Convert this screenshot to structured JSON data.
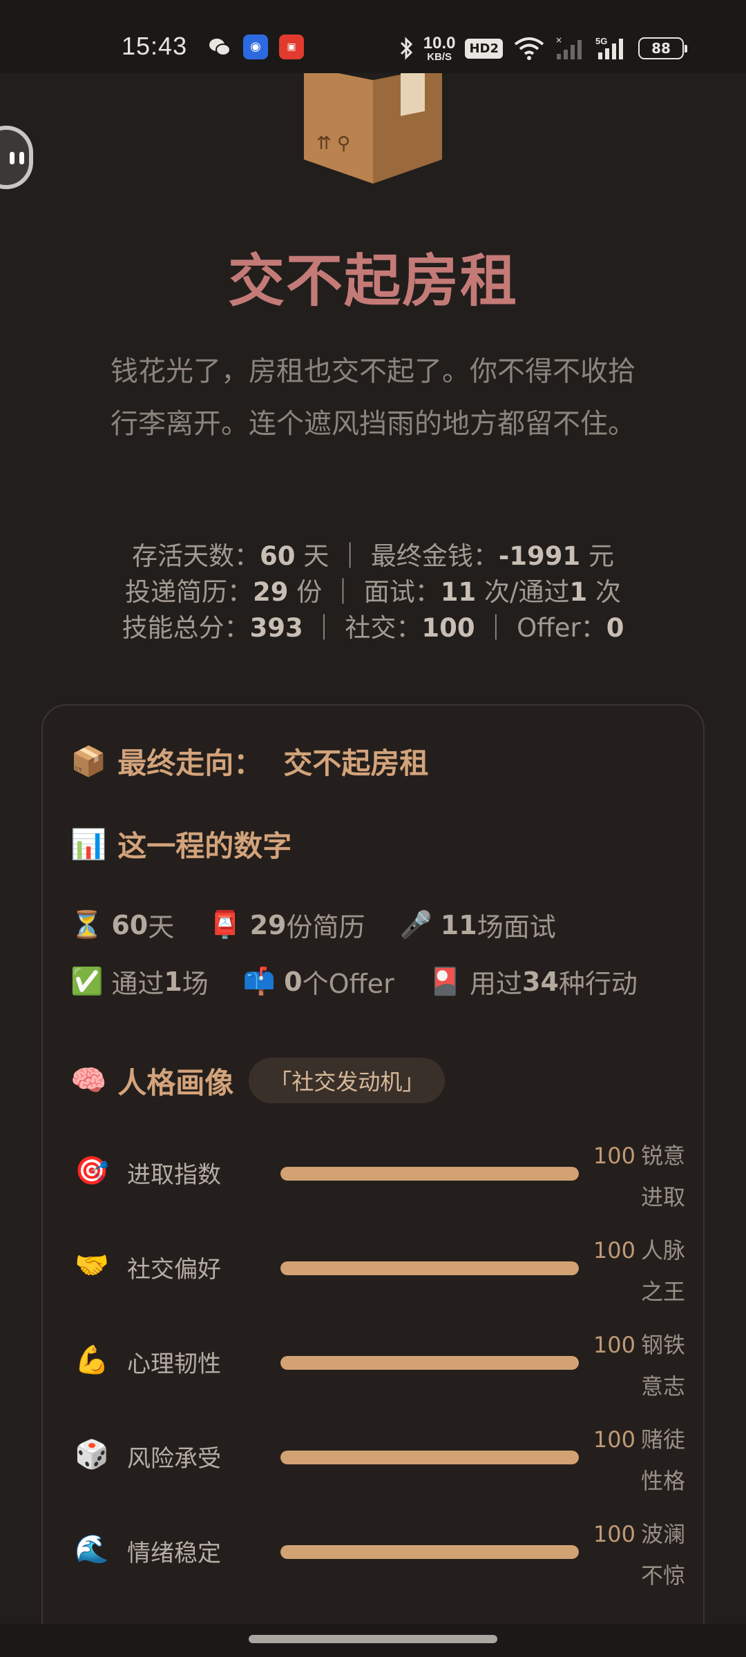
{
  "status_bar": {
    "time": "15:43",
    "net_speed": "10.0",
    "net_unit": "KB/S",
    "hd": "HD2",
    "battery": "88",
    "icons": [
      "wechat-icon",
      "app-blue-icon",
      "app-red-icon",
      "bluetooth-icon",
      "wifi-icon",
      "signal-icon",
      "signal-5g-icon"
    ]
  },
  "ending": {
    "icon": "📦",
    "title": "交不起房租",
    "description": "钱花光了，房租也交不起了。你不得不收拾行李离开。连个遮风挡雨的地方都留不住。"
  },
  "stats": {
    "line1": {
      "days_label": "存活天数：",
      "days": "60",
      "days_unit": " 天 ｜ 最终金钱：",
      "money": "-1991",
      "money_unit": " 元"
    },
    "line2": {
      "resume_label": "投递简历：",
      "resumes": "29",
      "resume_unit": " 份 ｜ 面试：",
      "interviews": "11",
      "interview_mid": " 次/通过",
      "passed": "1",
      "passed_unit": " 次"
    },
    "line3": {
      "skill_label": "技能总分：",
      "skill": "393",
      "social_label": " ｜ 社交：",
      "social": "100",
      "offer_label": " ｜ Offer：",
      "offer": "0"
    }
  },
  "card": {
    "final": {
      "icon": "📦",
      "label": "最终走向：",
      "value": "交不起房租"
    },
    "numbers": {
      "icon": "📊",
      "label": "这一程的数字",
      "items": [
        {
          "icon": "⏳",
          "value": "60",
          "unit": "天"
        },
        {
          "icon": "📮",
          "value": "29",
          "unit": "份简历"
        },
        {
          "icon": "🎤",
          "value": "11",
          "unit": "场面试"
        },
        {
          "icon": "✅",
          "prefix": "通过",
          "value": "1",
          "unit": "场"
        },
        {
          "icon": "📫",
          "value": "0",
          "unit": "个Offer"
        },
        {
          "icon": "🎴",
          "prefix": "用过",
          "value": "34",
          "unit": "种行动"
        }
      ]
    },
    "persona": {
      "icon": "🧠",
      "label": "人格画像",
      "tag": "「社交发动机」",
      "traits": [
        {
          "icon": "🎯",
          "name": "进取指数",
          "score": "100",
          "desc": "锐意进取",
          "level": 1.0
        },
        {
          "icon": "🤝",
          "name": "社交偏好",
          "score": "100",
          "desc": "人脉之王",
          "level": 1.0
        },
        {
          "icon": "💪",
          "name": "心理韧性",
          "score": "100",
          "desc": "钢铁意志",
          "level": 1.0
        },
        {
          "icon": "🎲",
          "name": "风险承受",
          "score": "100",
          "desc": "赌徒性格",
          "level": 1.0
        },
        {
          "icon": "🌊",
          "name": "情绪稳定",
          "score": "100",
          "desc": "波澜不惊",
          "level": 1.0
        }
      ]
    }
  }
}
